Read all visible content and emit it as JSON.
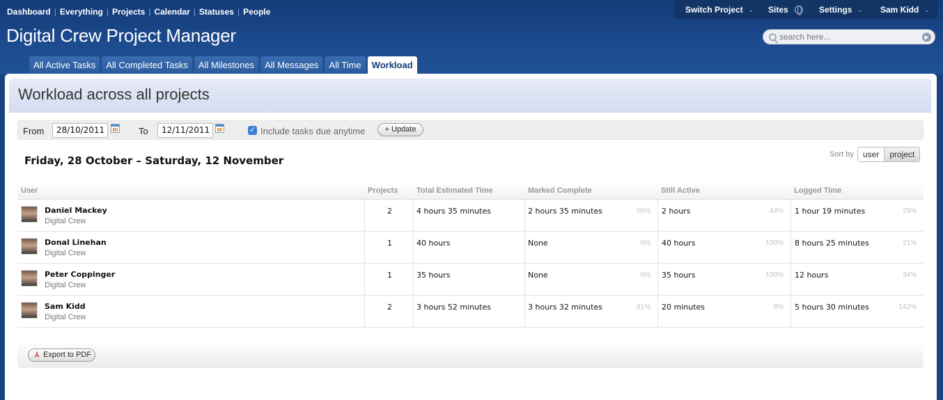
{
  "nav": {
    "items": [
      "Dashboard",
      "Everything",
      "Projects",
      "Calendar",
      "Statuses",
      "People"
    ]
  },
  "app_title": "Digital Crew Project Manager",
  "topbar": {
    "switch_project": "Switch Project",
    "sites": "Sites",
    "settings": "Settings",
    "user": "Sam Kidd"
  },
  "search": {
    "placeholder": "search here..."
  },
  "tabs": [
    "All Active Tasks",
    "All Completed Tasks",
    "All Milestones",
    "All Messages",
    "All Time",
    "Workload"
  ],
  "page": {
    "title": "Workload across all projects"
  },
  "filter": {
    "from_label": "From",
    "from_value": "28/10/2011",
    "to_label": "To",
    "to_value": "12/11/2011",
    "include_label": "Include tasks due anytime",
    "include_checked": true,
    "update_label": "Update"
  },
  "range_label": "Friday, 28 October – Saturday, 12 November",
  "sort": {
    "label": "Sort by",
    "options": [
      "user",
      "project"
    ],
    "selected": "user"
  },
  "table": {
    "headers": [
      "User",
      "Projects",
      "Total Estimated Time",
      "Marked Complete",
      "Still Active",
      "Logged Time"
    ],
    "rows": [
      {
        "name": "Daniel Mackey",
        "company": "Digital Crew",
        "projects": "2",
        "total": "4 hours 35 minutes",
        "complete": "2 hours 35 minutes",
        "complete_pct": "56%",
        "active": "2 hours",
        "active_pct": "44%",
        "logged": "1 hour 19 minutes",
        "logged_pct": "29%"
      },
      {
        "name": "Donal Linehan",
        "company": "Digital Crew",
        "projects": "1",
        "total": "40 hours",
        "complete": "None",
        "complete_pct": "0%",
        "active": "40 hours",
        "active_pct": "100%",
        "logged": "8 hours 25 minutes",
        "logged_pct": "21%"
      },
      {
        "name": "Peter Coppinger",
        "company": "Digital Crew",
        "projects": "1",
        "total": "35 hours",
        "complete": "None",
        "complete_pct": "0%",
        "active": "35 hours",
        "active_pct": "100%",
        "logged": "12 hours",
        "logged_pct": "34%"
      },
      {
        "name": "Sam Kidd",
        "company": "Digital Crew",
        "projects": "2",
        "total": "3 hours 52 minutes",
        "complete": "3 hours 32 minutes",
        "complete_pct": "91%",
        "active": "20 minutes",
        "active_pct": "9%",
        "logged": "5 hours 30 minutes",
        "logged_pct": "142%"
      }
    ]
  },
  "export_label": "Export to PDF"
}
